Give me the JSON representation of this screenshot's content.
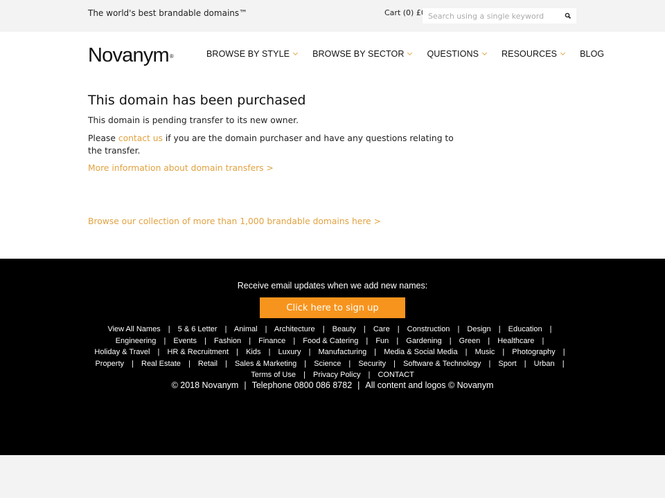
{
  "topbar": {
    "tagline": "The world's best brandable domains™",
    "cart": "Cart (0) £0",
    "search_placeholder": "Search using a single keyword",
    "search_icon": "magnifier-icon"
  },
  "header": {
    "logo": "Novanym",
    "logo_mark": "®",
    "nav": [
      {
        "label": "BROWSE BY STYLE",
        "dropdown": true
      },
      {
        "label": "BROWSE BY SECTOR",
        "dropdown": true
      },
      {
        "label": "QUESTIONS",
        "dropdown": true
      },
      {
        "label": "RESOURCES",
        "dropdown": true
      },
      {
        "label": "BLOG",
        "dropdown": false
      }
    ]
  },
  "main": {
    "title": "This domain has been purchased",
    "pending": "This domain is pending transfer to its new owner.",
    "please": "Please ",
    "contact_link": "contact us",
    "contact_rest": " if you are the domain purchaser and have any questions relating to the transfer.",
    "more_info_link": "More information about domain transfers >",
    "browse_link": "Browse our collection of more than 1,000 brandable domains here >"
  },
  "footer": {
    "signup_text": "Receive email updates when we add new names:",
    "signup_button": "Click here to sign up",
    "links": [
      "View All Names",
      "5 & 6 Letter",
      "Animal",
      "Architecture",
      "Beauty",
      "Care",
      "Construction",
      "Design",
      "Education",
      "Engineering",
      "Events",
      "Fashion",
      "Finance",
      "Food & Catering",
      "Fun",
      "Gardening",
      "Green",
      "Healthcare",
      "Holiday & Travel",
      "HR & Recruitment",
      "Kids",
      "Luxury",
      "Manufacturing",
      "Media & Social Media",
      "Music",
      "Photography",
      "Property",
      "Real Estate",
      "Retail",
      "Sales & Marketing",
      "Science",
      "Security",
      "Software & Technology",
      "Sport",
      "Urban",
      "Terms of Use",
      "Privacy Policy",
      "CONTACT"
    ],
    "copyright": "© 2018 Novanym",
    "telephone": "Telephone 0800 086 8782",
    "rights": "All content and logos © Novanym"
  },
  "colors": {
    "accent_link": "#e1a242",
    "signup_button": "#f7941d",
    "footer_bg": "#000000",
    "topbar_bg": "#f3f3f3"
  }
}
